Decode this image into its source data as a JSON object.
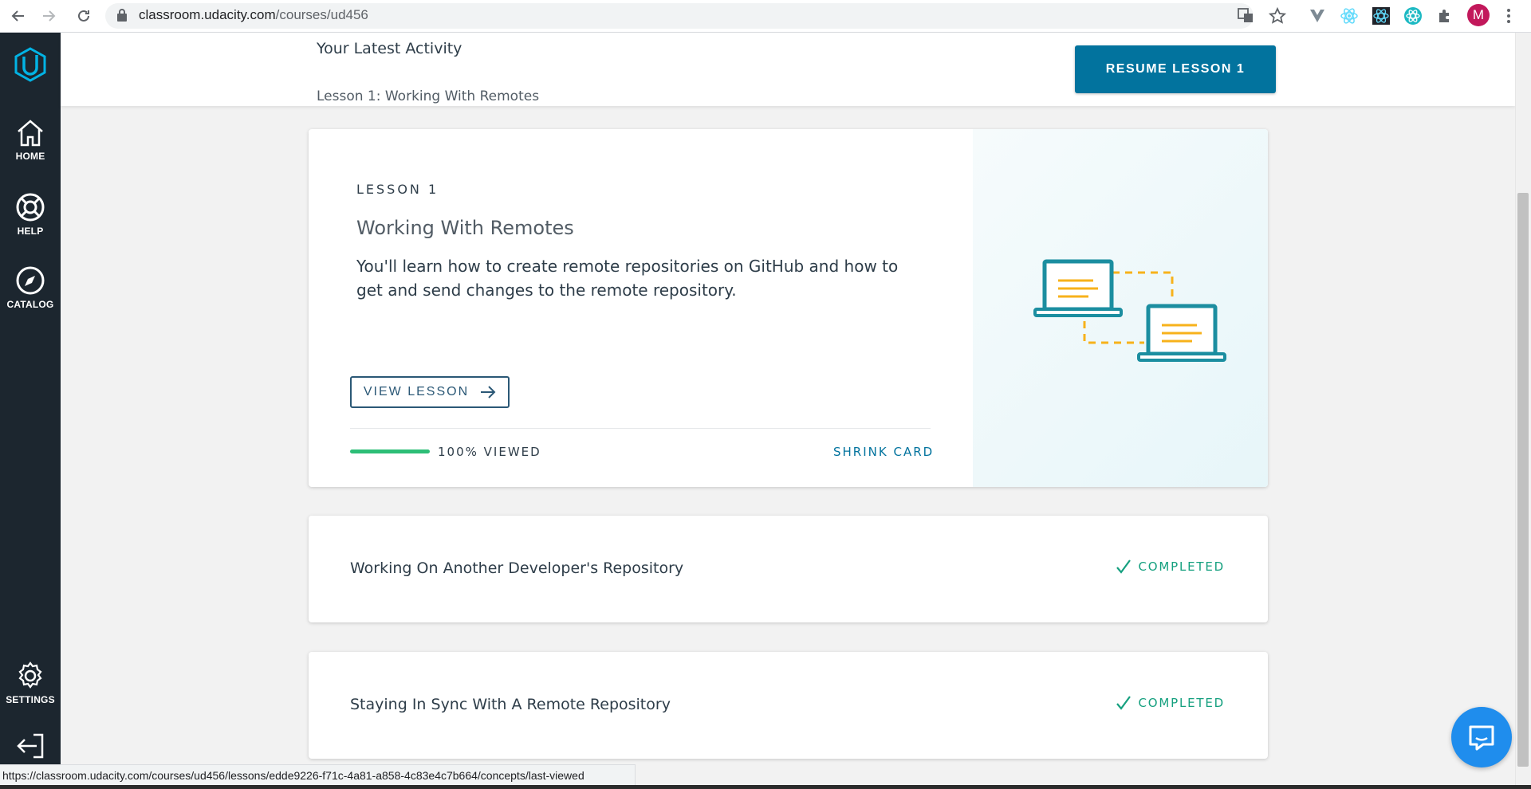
{
  "browser": {
    "url_host": "classroom.udacity.com",
    "url_path": "/courses/ud456",
    "avatar_initial": "M"
  },
  "sidebar": {
    "items": [
      {
        "label": "HOME",
        "icon": "home-icon"
      },
      {
        "label": "HELP",
        "icon": "lifebuoy-icon"
      },
      {
        "label": "CATALOG",
        "icon": "compass-icon"
      },
      {
        "label": "SETTINGS",
        "icon": "gear-icon"
      }
    ],
    "logout_icon": "logout-icon"
  },
  "activity": {
    "title": "Your Latest Activity",
    "subtitle": "Lesson 1: Working With Remotes",
    "resume_label": "RESUME LESSON 1"
  },
  "lesson": {
    "kicker": "LESSON 1",
    "title": "Working With Remotes",
    "description": "You'll learn how to create remote repositories on GitHub and how to get and send changes to the remote repository.",
    "view_label": "VIEW LESSON",
    "progress_percent": 100,
    "progress_label": "100% VIEWED",
    "shrink_label": "SHRINK CARD"
  },
  "concepts": [
    {
      "title": "Working On Another Developer's Repository",
      "status": "COMPLETED"
    },
    {
      "title": "Staying In Sync With A Remote Repository",
      "status": "COMPLETED"
    }
  ],
  "status_bar": {
    "url": "https://classroom.udacity.com/courses/ud456/lessons/edde9226-f71c-4a81-a858-4c83e4c7b664/concepts/last-viewed"
  },
  "colors": {
    "brand": "#02739e",
    "sidebar": "#1c262f",
    "success": "#15a07f",
    "progress": "#2dbe77",
    "accent_art": "#f7b21b"
  }
}
